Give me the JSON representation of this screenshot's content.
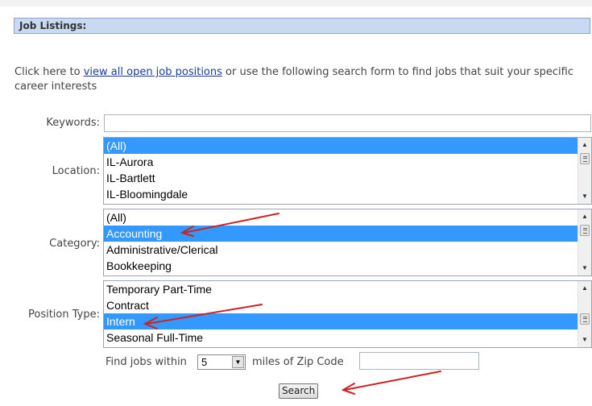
{
  "header": {
    "title": "Job Listings:"
  },
  "intro": {
    "before": "Click here to ",
    "link": "view all open job positions",
    "after": " or use the following search form to find jobs that suit your specific career interests"
  },
  "form": {
    "keywords": {
      "label": "Keywords:",
      "value": ""
    },
    "location": {
      "label": "Location:",
      "options": [
        {
          "text": "(All)",
          "selected": true
        },
        {
          "text": "IL-Aurora",
          "selected": false
        },
        {
          "text": "IL-Bartlett",
          "selected": false
        },
        {
          "text": "IL-Bloomingdale",
          "selected": false
        }
      ]
    },
    "category": {
      "label": "Category:",
      "options": [
        {
          "text": "(All)",
          "selected": false
        },
        {
          "text": "Accounting",
          "selected": true
        },
        {
          "text": "Administrative/Clerical",
          "selected": false
        },
        {
          "text": "Bookkeeping",
          "selected": false
        }
      ]
    },
    "position_type": {
      "label": "Position Type:",
      "options": [
        {
          "text": "Temporary Part-Time",
          "selected": false
        },
        {
          "text": "Contract",
          "selected": false
        },
        {
          "text": "Intern",
          "selected": true
        },
        {
          "text": "Seasonal Full-Time",
          "selected": false
        }
      ]
    },
    "distance": {
      "prefix": "Find jobs within",
      "miles_value": "5",
      "suffix": "miles of Zip Code",
      "zip_value": ""
    },
    "search_label": "Search"
  },
  "colors": {
    "selection": "#3399ff",
    "header_bg": "#c9d9f2",
    "arrow": "#cc2222",
    "link": "#1a3d9c"
  }
}
